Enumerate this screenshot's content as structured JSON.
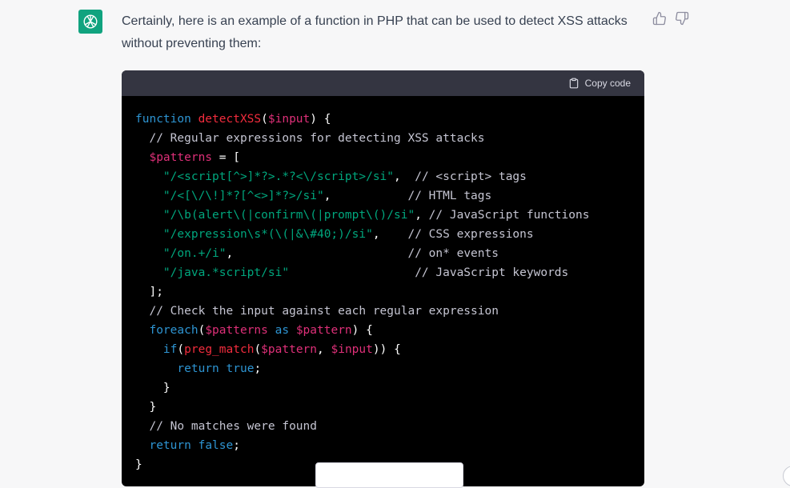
{
  "message": {
    "text": "Certainly, here is an example of a function in PHP that can be used to detect XSS attacks without preventing them:"
  },
  "code_block": {
    "copy_label": "Copy code",
    "lines": [
      [
        [
          "kw",
          "function "
        ],
        [
          "fn",
          "detectXSS"
        ],
        [
          "plain",
          "("
        ],
        [
          "var",
          "$input"
        ],
        [
          "plain",
          ") {"
        ]
      ],
      [
        [
          "plain",
          "  "
        ],
        [
          "cm",
          "// Regular expressions for detecting XSS attacks"
        ]
      ],
      [
        [
          "plain",
          "  "
        ],
        [
          "var",
          "$patterns"
        ],
        [
          "plain",
          " = ["
        ]
      ],
      [
        [
          "plain",
          "    "
        ],
        [
          "str",
          "\"/<script[^>]*?>.*?<\\/script>/si\""
        ],
        [
          "plain",
          ",  "
        ],
        [
          "cm",
          "// <script> tags"
        ]
      ],
      [
        [
          "plain",
          "    "
        ],
        [
          "str",
          "\"/<[\\/\\!]*?[^<>]*?>/si\""
        ],
        [
          "plain",
          ",           "
        ],
        [
          "cm",
          "// HTML tags"
        ]
      ],
      [
        [
          "plain",
          "    "
        ],
        [
          "str",
          "\"/\\b(alert\\(|confirm\\(|prompt\\()/si\""
        ],
        [
          "plain",
          ", "
        ],
        [
          "cm",
          "// JavaScript functions"
        ]
      ],
      [
        [
          "plain",
          "    "
        ],
        [
          "str",
          "\"/expression\\s*(\\(|&\\#40;)/si\""
        ],
        [
          "plain",
          ",    "
        ],
        [
          "cm",
          "// CSS expressions"
        ]
      ],
      [
        [
          "plain",
          "    "
        ],
        [
          "str",
          "\"/on.+/i\""
        ],
        [
          "plain",
          ",                         "
        ],
        [
          "cm",
          "// on* events"
        ]
      ],
      [
        [
          "plain",
          "    "
        ],
        [
          "str",
          "\"/java.*script/si\""
        ],
        [
          "plain",
          "                  "
        ],
        [
          "cm",
          "// JavaScript keywords"
        ]
      ],
      [
        [
          "plain",
          "  ];"
        ]
      ],
      [
        [
          "plain",
          "  "
        ],
        [
          "cm",
          "// Check the input against each regular expression"
        ]
      ],
      [
        [
          "plain",
          "  "
        ],
        [
          "kw",
          "foreach"
        ],
        [
          "plain",
          "("
        ],
        [
          "var",
          "$patterns"
        ],
        [
          "plain",
          " "
        ],
        [
          "kw",
          "as"
        ],
        [
          "plain",
          " "
        ],
        [
          "var",
          "$pattern"
        ],
        [
          "plain",
          ") {"
        ]
      ],
      [
        [
          "plain",
          "    "
        ],
        [
          "kw",
          "if"
        ],
        [
          "plain",
          "("
        ],
        [
          "fn",
          "preg_match"
        ],
        [
          "plain",
          "("
        ],
        [
          "var",
          "$pattern"
        ],
        [
          "plain",
          ", "
        ],
        [
          "var",
          "$input"
        ],
        [
          "plain",
          ")) {"
        ]
      ],
      [
        [
          "plain",
          "      "
        ],
        [
          "kw",
          "return"
        ],
        [
          "plain",
          " "
        ],
        [
          "kw",
          "true"
        ],
        [
          "plain",
          ";"
        ]
      ],
      [
        [
          "plain",
          "    }"
        ]
      ],
      [
        [
          "plain",
          "  }"
        ]
      ],
      [
        [
          "plain",
          "  "
        ],
        [
          "cm",
          "// No matches were found"
        ]
      ],
      [
        [
          "plain",
          "  "
        ],
        [
          "kw",
          "return"
        ],
        [
          "plain",
          " "
        ],
        [
          "kw",
          "false"
        ],
        [
          "plain",
          ";"
        ]
      ],
      [
        [
          "plain",
          "}"
        ]
      ]
    ]
  },
  "colors": {
    "avatar_bg": "#10a37f",
    "keyword": "#2e95d3",
    "function": "#f22c3d",
    "variable": "#df3079",
    "string": "#00a67d",
    "comment": "#c5c5d2"
  },
  "icons": {
    "avatar": "openai-logo-icon",
    "thumbs_up": "thumbs-up-icon",
    "thumbs_down": "thumbs-down-icon",
    "copy": "clipboard-icon"
  }
}
